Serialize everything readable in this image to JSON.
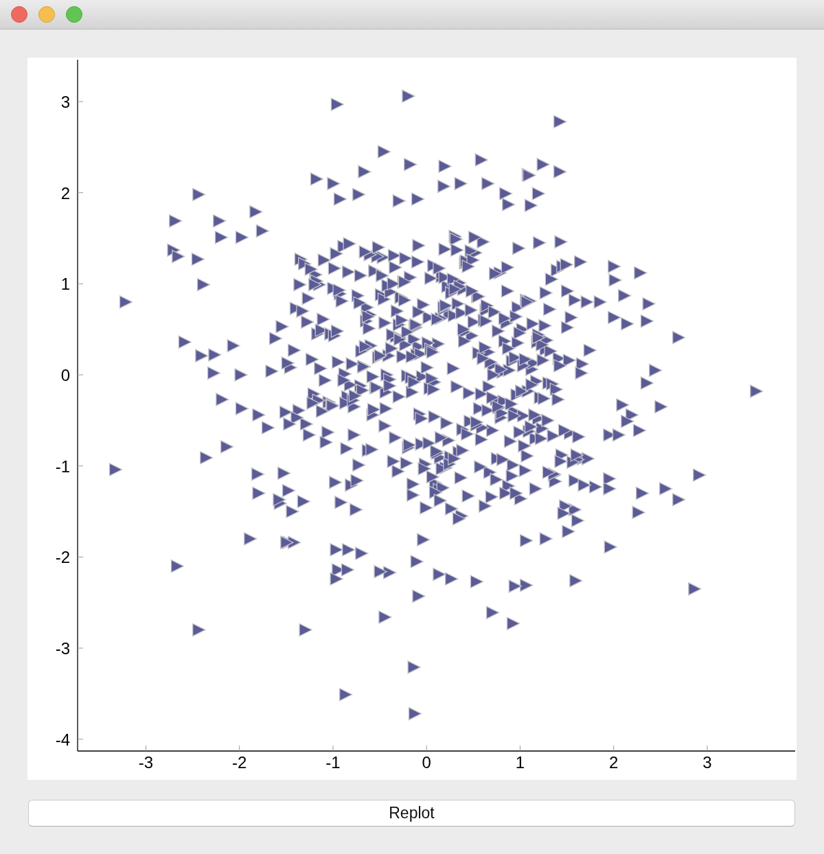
{
  "plot": {
    "chart_data": {
      "type": "scatter",
      "xlim": [
        -3.73,
        3.94
      ],
      "ylim": [
        -4.13,
        3.46
      ],
      "xticks": [
        -3,
        -2,
        -1,
        0,
        1,
        2,
        3
      ],
      "yticks": [
        -4,
        -3,
        -2,
        -1,
        0,
        1,
        2,
        3
      ],
      "x": [
        -0.96,
        -0.2,
        1.42,
        -3.22,
        -3.33,
        3.52,
        2.91,
        2.86,
        -2.67,
        -2.44,
        -1.3,
        -0.14,
        -0.87,
        -0.13,
        -0.45,
        0.7,
        0.92,
        1.59,
        1.96,
        -2.69,
        -2.44,
        -2.71,
        -2.66,
        -2.59,
        -2.39,
        -2.36,
        -1.89,
        -1.48,
        2.69,
        2.37,
        2.5,
        2.28,
        2.3,
        2.55,
        2.69,
        2.26,
        1.42,
        1.24,
        0.58,
        1.08,
        -2.45,
        -2.22,
        -2.2,
        -1.98,
        -1.83,
        -1.76,
        -2.41,
        -2.27,
        -2.28,
        -2.19,
        -2.07,
        -1.99,
        -2.14,
        -1.98,
        -1.8,
        -1.81,
        -1.8,
        -0.67,
        -0.46,
        -0.18,
        0.19,
        -1.18,
        -1.0,
        -0.93,
        -0.73,
        -0.3,
        -0.1,
        0.18,
        0.36,
        0.65,
        0.84,
        1.09,
        1.19,
        1.11,
        0.87,
        1.64,
        1.43,
        2.0,
        2.01,
        2.11,
        1.85,
        1.58,
        2.0,
        2.14,
        2.35,
        2.44,
        2.35,
        2.09,
        2.19,
        2.14,
        2.27,
        1.95,
        2.05,
        1.95,
        1.95,
        1.8,
        1.67,
        1.72,
        1.58,
        1.61,
        1.51,
        1.27,
        1.06,
        1.06,
        0.94,
        0.53,
        0.26,
        0.13,
        -0.11,
        -0.09,
        -0.4,
        -0.5,
        -0.95,
        -0.85,
        -0.97,
        -0.97,
        -0.84,
        -0.7,
        -0.04,
        -1.42,
        -1.5,
        0.12,
        -0.45,
        0.78,
        -1.21,
        0.33,
        1.05,
        -0.67,
        0.02,
        1.44,
        -0.89,
        0.56,
        -0.12,
        -1.48,
        0.91,
        -0.34,
        1.27,
        -0.76,
        0.63,
        -0.05,
        -0.58,
        0.41,
        1.12,
        -0.22,
        0.85,
        -1.05,
        0.19,
        1.58,
        -0.41,
        0.7,
        -0.93,
        0.08,
        1.33,
        -1.32,
        0.48,
        -0.16,
        0.97,
        -0.63,
        0.3,
        1.66,
        0.24,
        -0.81,
        0.66,
        -1.15,
        1.19,
        0.05,
        -0.47,
        0.89,
        -1.62,
        0.37,
        1.41,
        -0.28,
        0.74,
        -0.99,
        0.14,
        1.02,
        -0.55,
        0.52,
        -1.26,
        0.81,
        -0.36,
        0.99,
        -0.71,
        0.16,
        1.23,
        -1.4,
        0.44,
        -0.09,
        1.5,
        -0.85,
        0.6,
        0.28,
        1.36,
        -1.11,
        0.07,
        0.93,
        -0.52,
        1.16,
        -0.24,
        0.71,
        -1.02,
        0.35,
        1.48,
        -0.3,
        0.03,
        -0.74,
        1.09,
        -1.35,
        0.55,
        0.2,
        -0.61,
        1.3,
        -0.14,
        0.87,
        -1.19,
        0.46,
        1.71,
        -0.43,
        0.11,
        -0.97,
        0.58,
        -0.26,
        1.21,
        0.39,
        -1.53,
        0.76,
        -0.08,
        1.39,
        -0.69,
        0.15,
        1.0,
        -0.38,
        0.64,
        -1.29,
        0.31,
        -0.02,
        1.14,
        -0.87,
        0.5,
        1.53,
        -0.49,
        0.09,
        0.83,
        -1.09,
        0.42,
        -0.2,
        1.26,
        -0.78,
        0.68,
        -1.44,
        0.22,
        0.96,
        -0.32,
        1.61,
        -0.6,
        0.04,
        0.79,
        -1.17,
        0.36,
        -0.11,
        1.07,
        -0.65,
        0.47,
        -1.37,
        0.88,
        0.13,
        -0.91,
        1.34,
        -0.25,
        0.59,
        1.18,
        -1.57,
        0.26,
        -0.44,
        0.95,
        -0.06,
        1.45,
        -0.79,
        0.4,
        0.67,
        -1.23,
        0.18,
        1.03,
        -0.35,
        1.62,
        -0.7,
        0.32,
        -1.0,
        0.84,
        -0.13,
        1.25,
        -0.56,
        0.1,
        -1.46,
        0.72,
        1.37,
        -0.29,
        0.53,
        -0.83,
        0.01,
        0.92,
        -0.46,
        1.17,
        -1.13,
        0.34,
        -0.18,
        0.77,
        1.52,
        -0.64,
        0.23,
        -1.31,
        1.08,
        -0.03,
        0.61,
        -0.88,
        1.29,
        -0.39,
        0.17,
        1.74,
        -0.72,
        0.45,
        -1.06,
        0.86,
        0.06,
        -0.33,
        1.42,
        -0.59,
        0.29,
        -1.51,
        0.98,
        -0.21,
        0.69,
        1.13,
        -0.94,
        0.38,
        -0.07,
        1.56,
        -0.48,
        0.82,
        0.21,
        -1.18,
        0.62,
        -0.15,
        1.31,
        -0.82,
        0.49,
        1.04,
        -0.37,
        -1.66,
        0.75,
        0.11,
        -0.57,
        1.2,
        -0.01,
        0.94,
        -1.27,
        0.43,
        -0.23,
        1.38,
        -0.42,
        0.8,
        -0.95,
        0.25,
        1.49,
        -0.62,
        0.09,
        -1.42,
        1.11,
        0.54,
        -0.17,
        0.73,
        -1.08,
        1.28,
        -0.31,
        0.37,
        -0.77,
        1.65,
        0.14,
        -0.53,
        1.01,
        -0.27,
        0.57,
        -1.24,
        0.9,
        -0.04,
        1.35,
        -0.68,
        0.32,
        -0.98,
        1.19,
        0.08,
        -1.36,
        0.66,
        -0.12,
        1.46,
        -0.5,
        0.19,
        -0.86,
        0.97,
        0.39,
        -1.58,
        0.86,
        -0.4,
        1.22,
        -0.1,
        0.6,
        -0.73,
        1.54,
        -1.16,
        0.28,
        0.91,
        -0.29,
        -1.01,
        1.06,
        -0.61,
        0.79,
        -1.39,
        0.47,
        -0.19,
        1.32,
        -0.84,
        0.53,
        0.0,
        1.16,
        -1.28,
        0.35,
        -0.54,
        0.99,
        -0.09,
        1.43,
        -0.66,
        0.18,
        -1.12,
        0.74,
        1.24,
        -0.36,
        0.58,
        -0.92,
        0.83,
        -0.14,
        1.6,
        -1.03,
        0.44,
        -0.44,
        1.1,
        0.26,
        -0.8,
        0.63,
        -1.47,
        0.04,
        1.36,
        -0.23,
        0.7,
        -0.99,
        0.15,
        1.27,
        -0.58,
        0.51,
        -1.22,
        0.3,
        0.95,
        -0.16,
        1.47,
        -0.71,
        0.07,
        -1.55,
        0.81,
        0.4,
        -0.34,
        1.15,
        -0.89,
        0.2,
        1.68,
        -0.45,
        0.65,
        -1.1,
        0.02,
        1.03,
        0.55,
        -0.75,
        1.23,
        -0.06,
        -1.33,
        0.71,
        0.16,
        -0.52,
        1.4,
        -0.96,
        0.34,
        1.05,
        -0.24,
        -1.7,
        0.87,
        -0.15,
        0.48,
        1.12,
        -0.63,
        0.24,
        -0.3,
        1.19,
        -1.14,
        0.62,
        0.13,
        -0.78,
        1.5,
        -0.4,
        0.38,
        -1.2,
        0.93,
        0.06,
        -0.66,
        1.3,
        -0.09,
        0.76,
        -1.49,
        0.29,
        1.07,
        -0.21
      ],
      "series": [
        {
          "color": "#5b5b97",
          "values": [
            2.97,
            3.06,
            2.78,
            0.8,
            -1.04,
            -0.18,
            -1.1,
            -2.35,
            -2.1,
            -2.8,
            -2.8,
            -3.21,
            -3.51,
            -3.72,
            -2.66,
            -2.61,
            -2.73,
            -2.26,
            -1.89,
            1.69,
            1.98,
            1.37,
            1.3,
            0.36,
            0.99,
            -0.91,
            -1.8,
            -1.84,
            0.41,
            0.78,
            -0.35,
            1.12,
            -1.3,
            -1.25,
            -1.37,
            -1.51,
            2.23,
            2.31,
            2.36,
            2.2,
            1.27,
            1.69,
            1.51,
            1.51,
            1.79,
            1.58,
            0.21,
            0.22,
            0.02,
            -0.27,
            0.32,
            0.0,
            -0.79,
            -0.37,
            -0.44,
            -1.09,
            -1.3,
            2.23,
            2.45,
            2.31,
            2.29,
            2.15,
            2.1,
            1.93,
            1.98,
            1.91,
            1.93,
            2.07,
            2.1,
            2.1,
            1.99,
            2.19,
            1.99,
            1.86,
            1.87,
            1.24,
            1.46,
            1.19,
            1.04,
            0.87,
            0.8,
            0.82,
            0.63,
            0.56,
            0.59,
            0.05,
            -0.09,
            -0.33,
            -0.44,
            -0.51,
            -0.61,
            -0.66,
            -0.66,
            -1.14,
            -1.25,
            -1.23,
            -0.92,
            -0.92,
            -1.48,
            -1.6,
            -1.72,
            -1.8,
            -1.82,
            -2.31,
            -2.32,
            -2.27,
            -2.24,
            -2.19,
            -2.05,
            -2.43,
            -2.17,
            -2.16,
            -2.14,
            -2.14,
            -2.24,
            -1.92,
            -1.92,
            -1.96,
            -1.81,
            -1.84,
            -1.84,
            0.34,
            -0.56,
            1.12,
            -0.21,
            0.78,
            -1.05,
            0.09,
            0.63,
            -0.88,
            1.41,
            -0.37,
            0.52,
            -1.27,
            0.15,
            -0.69,
            0.28,
            -1.48,
            0.71,
            -0.02,
            -0.44,
            1.23,
            0.06,
            -0.97,
            0.57,
            -0.3,
            1.38,
            -1.16,
            0.21,
            -0.61,
            0.89,
            -0.08,
            1.05,
            -1.39,
            0.43,
            -0.19,
            0.74,
            -0.83,
            1.52,
            0.12,
            0.67,
            -1.21,
            0.25,
            0.99,
            -0.48,
            -0.04,
            1.29,
            -0.73,
            0.4,
            -1.55,
            0.18,
            0.85,
            -0.27,
            1.17,
            -0.91,
            0.5,
            -0.14,
            1.34,
            -0.66,
            0.03,
            -0.95,
            0.46,
            -0.12,
            1.08,
            -0.59,
            0.73,
            -1.33,
            0.31,
            0.92,
            -0.24,
            1.46,
            0.07,
            -1.1,
            0.61,
            1.2,
            -0.4,
            0.19,
            -0.7,
            0.82,
            0.11,
            -0.33,
            1.01,
            -1.44,
            0.55,
            -0.15,
            0.87,
            -0.62,
            1.27,
            0.24,
            -1.02,
            0.66,
            -0.09,
            0.39,
            -1.22,
            1.1,
            -0.51,
            0.8,
            0.0,
            -0.86,
            1.33,
            -0.71,
            0.2,
            -0.25,
            0.94,
            -1.08,
            0.48,
            -0.43,
            1.15,
            -0.17,
            0.62,
            -1.36,
            0.29,
            0.76,
            -0.54,
            1.49,
            -0.98,
            0.13,
            -0.31,
            0.58,
            -0.64,
            0.88,
            -1.19,
            0.37,
            -0.06,
            1.25,
            -0.8,
            0.54,
            -0.35,
            0.14,
            -1.5,
            0.97,
            -0.22,
            0.7,
            -0.93,
            0.32,
            1.06,
            -0.47,
            0.45,
            -1.13,
            0.22,
            -0.89,
            0.59,
            1.36,
            -0.39,
            0.05,
            -1.26,
            0.81,
            -0.1,
            1.02,
            -0.58,
            0.36,
            -1.41,
            0.9,
            -0.19,
            0.64,
            -0.76,
            1.19,
            -0.28,
            0.47,
            -1.07,
            0.17,
            0.72,
            -0.45,
            1.31,
            -0.68,
            0.26,
            -0.13,
            0.95,
            -1.3,
            0.53,
            -0.26,
            1.14,
            -0.84,
            0.08,
            0.69,
            -1.17,
            0.41,
            -0.55,
            1.44,
            0.35,
            -0.99,
            0.83,
            -0.07,
            0.49,
            -1.58,
            1.07,
            -0.36,
            0.16,
            0.74,
            -0.72,
            1.22,
            -0.18,
            -1.03,
            0.6,
            0.01,
            -0.5,
            0.91,
            -1.24,
            0.27,
            0.79,
            -0.2,
            -0.63,
            1.18,
            -1.12,
            0.42,
            0.1,
            -0.82,
            0.65,
            -0.41,
            1.39,
            -0.01,
            -1.34,
            0.56,
            0.93,
            -0.6,
            0.23,
            -0.96,
            1.09,
            -0.29,
            -0.53,
            1.03,
            0.3,
            -1.2,
            0.72,
            -0.11,
            1.26,
            -0.78,
            0.44,
            0.04,
            -0.92,
            0.61,
            -0.38,
            1.45,
            -1.46,
            0.19,
            0.84,
            -0.65,
            0.33,
            -0.16,
            0.98,
            -0.42,
            0.14,
            -0.9,
            1.21,
            0.51,
            -1.29,
            0.27,
            -0.57,
            0.86,
            -0.03,
            1.11,
            -0.74,
            0.38,
            -1.06,
            0.68,
            -0.23,
            0.02,
            -1.38,
            1.3,
            -0.18,
            0.6,
            -1.01,
            1.16,
            -0.32,
            0.77,
            -0.67,
            0.09,
            1.37,
            -1.18,
            0.44,
            -0.46,
            0.99,
            -0.13,
            0.55,
            -1.52,
            0.21,
            1.07,
            -0.81,
            0.35,
            0.5,
            -1.37,
            0.92,
            -0.05,
            -0.7,
            1.24,
            0.18,
            -0.99,
            0.63,
            -0.28,
            1.05,
            -1.11,
            0.39,
            -0.34,
            0.82,
            1.32,
            0.06,
            -0.47,
            0.71,
            -0.77,
            0.26,
            1.13,
            -0.52,
            0.08,
            -1.25,
            0.58,
            0.97,
            -0.14,
            -0.63,
            1.42,
            -0.95,
            0.31,
            0.74,
            -0.4,
            -1.15,
            0.16,
            1.0,
            -0.21,
            -1.4,
            0.62,
            -0.08,
            -0.88,
            0.45,
            1.19,
            -0.37,
            0.81,
            -1.47,
            0.12,
            0.59,
            -0.54,
            0.28,
            -1.09,
            1.28,
            -0.25,
            0.43,
            -0.69,
            0.9,
            -0.02,
            1.51,
            -0.31,
            0.94,
            -1.3,
            0.2,
            -0.61,
            1.09,
            -0.16,
            0.53,
            -0.93,
            0.37,
            1.18,
            -0.44,
            -0.06,
            0.76,
            -1.21,
            0.57,
            -0.39,
            1.26,
            -0.75,
            0.1,
            0.86,
            -1.16,
            0.33,
            -0.48,
            0.7,
            0.0,
            -1.03,
            1.4,
            -0.27,
            0.48,
            -0.85,
            0.17,
            1.02,
            -0.58,
            0.29,
            -1.32,
            0.92,
            -0.11,
            0.64,
            -0.98,
            -0.24,
            0.41,
            0.07,
            -1.44,
            1.17,
            -0.66,
            0.52,
            -0.12,
            -0.83,
            0.99,
            -0.45,
            0.25,
            1.35,
            -1.07,
            0.69,
            -0.35,
            0.13,
            -0.92,
            0.8,
            0.47
          ]
        }
      ]
    }
  },
  "buttons": [
    "Replot"
  ]
}
